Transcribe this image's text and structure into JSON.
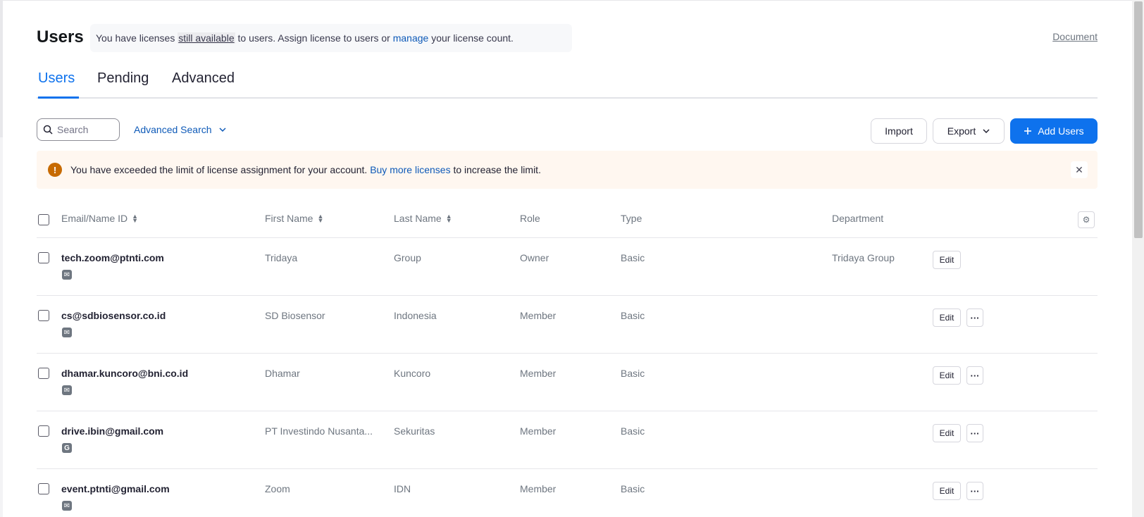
{
  "header": {
    "title": "Users",
    "banner_pre": "You have licenses ",
    "banner_underlined": "still available",
    "banner_mid": " to users. Assign license to users or ",
    "banner_link": "manage",
    "banner_post": " your license count.",
    "document_link": "Document"
  },
  "tabs": [
    {
      "label": "Users",
      "active": true
    },
    {
      "label": "Pending",
      "active": false
    },
    {
      "label": "Advanced",
      "active": false
    }
  ],
  "toolbar": {
    "search_placeholder": "Search",
    "advanced_search": "Advanced Search",
    "import": "Import",
    "export": "Export",
    "add_users": "Add Users"
  },
  "alert": {
    "text_pre": "You have exceeded the limit of license assignment for your account. ",
    "link": "Buy more licenses",
    "text_post": " to increase the limit."
  },
  "table": {
    "columns": {
      "email": "Email/Name ID",
      "first": "First Name",
      "last": "Last Name",
      "role": "Role",
      "type": "Type",
      "dept": "Department"
    },
    "edit_label": "Edit",
    "rows": [
      {
        "email": "tech.zoom@ptnti.com",
        "login": "email",
        "first": "Tridaya",
        "last": "Group",
        "role": "Owner",
        "type": "Basic",
        "dept": "Tridaya Group",
        "more": false
      },
      {
        "email": "cs@sdbiosensor.co.id",
        "login": "email",
        "first": "SD Biosensor",
        "last": "Indonesia",
        "role": "Member",
        "type": "Basic",
        "dept": "",
        "more": true
      },
      {
        "email": "dhamar.kuncoro@bni.co.id",
        "login": "email",
        "first": "Dhamar",
        "last": "Kuncoro",
        "role": "Member",
        "type": "Basic",
        "dept": "",
        "more": true
      },
      {
        "email": "drive.ibin@gmail.com",
        "login": "google",
        "first": "PT Investindo Nusanta...",
        "last": "Sekuritas",
        "role": "Member",
        "type": "Basic",
        "dept": "",
        "more": true
      },
      {
        "email": "event.ptnti@gmail.com",
        "login": "email",
        "first": "Zoom",
        "last": "IDN",
        "role": "Member",
        "type": "Basic",
        "dept": "",
        "more": true
      }
    ]
  },
  "colors": {
    "accent": "#0e72ed",
    "link": "#0e5ab8",
    "alert_bg": "#fff7f0",
    "alert_icon": "#c76a00"
  }
}
